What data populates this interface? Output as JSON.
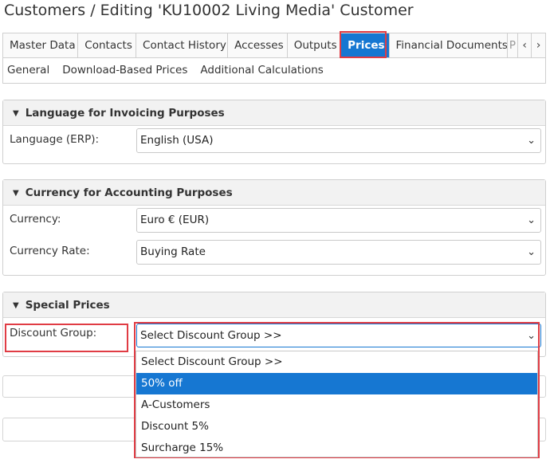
{
  "page_title": "Customers / Editing 'KU10002 Living Media' Customer",
  "tabs": {
    "items": [
      {
        "label": "Master Data"
      },
      {
        "label": "Contacts"
      },
      {
        "label": "Contact History"
      },
      {
        "label": "Accesses"
      },
      {
        "label": "Outputs"
      },
      {
        "label": "Prices",
        "active": true
      },
      {
        "label": "Financial Documents"
      },
      {
        "label": "P"
      }
    ],
    "prev_icon": "chevron-left-icon",
    "next_icon": "chevron-right-icon"
  },
  "subtabs": {
    "items": [
      {
        "label": "General"
      },
      {
        "label": "Download-Based Prices"
      },
      {
        "label": "Additional Calculations"
      }
    ]
  },
  "invoicing": {
    "title": "Language for Invoicing Purposes",
    "language_label": "Language (ERP):",
    "language_value": "English (USA)"
  },
  "currency": {
    "title": "Currency for Accounting Purposes",
    "currency_label": "Currency:",
    "currency_value": "Euro € (EUR)",
    "rate_label": "Currency Rate:",
    "rate_value": "Buying Rate"
  },
  "special": {
    "title": "Special Prices",
    "discount_label": "Discount Group:",
    "discount_value": "Select Discount Group >>",
    "options": [
      {
        "label": "Select Discount Group >>"
      },
      {
        "label": "50% off",
        "highlighted": true
      },
      {
        "label": "A-Customers"
      },
      {
        "label": "Discount 5%"
      },
      {
        "label": "Surcharge 15%"
      }
    ]
  },
  "colors": {
    "accent": "#1677d2",
    "highlight_border": "#e03c44"
  }
}
